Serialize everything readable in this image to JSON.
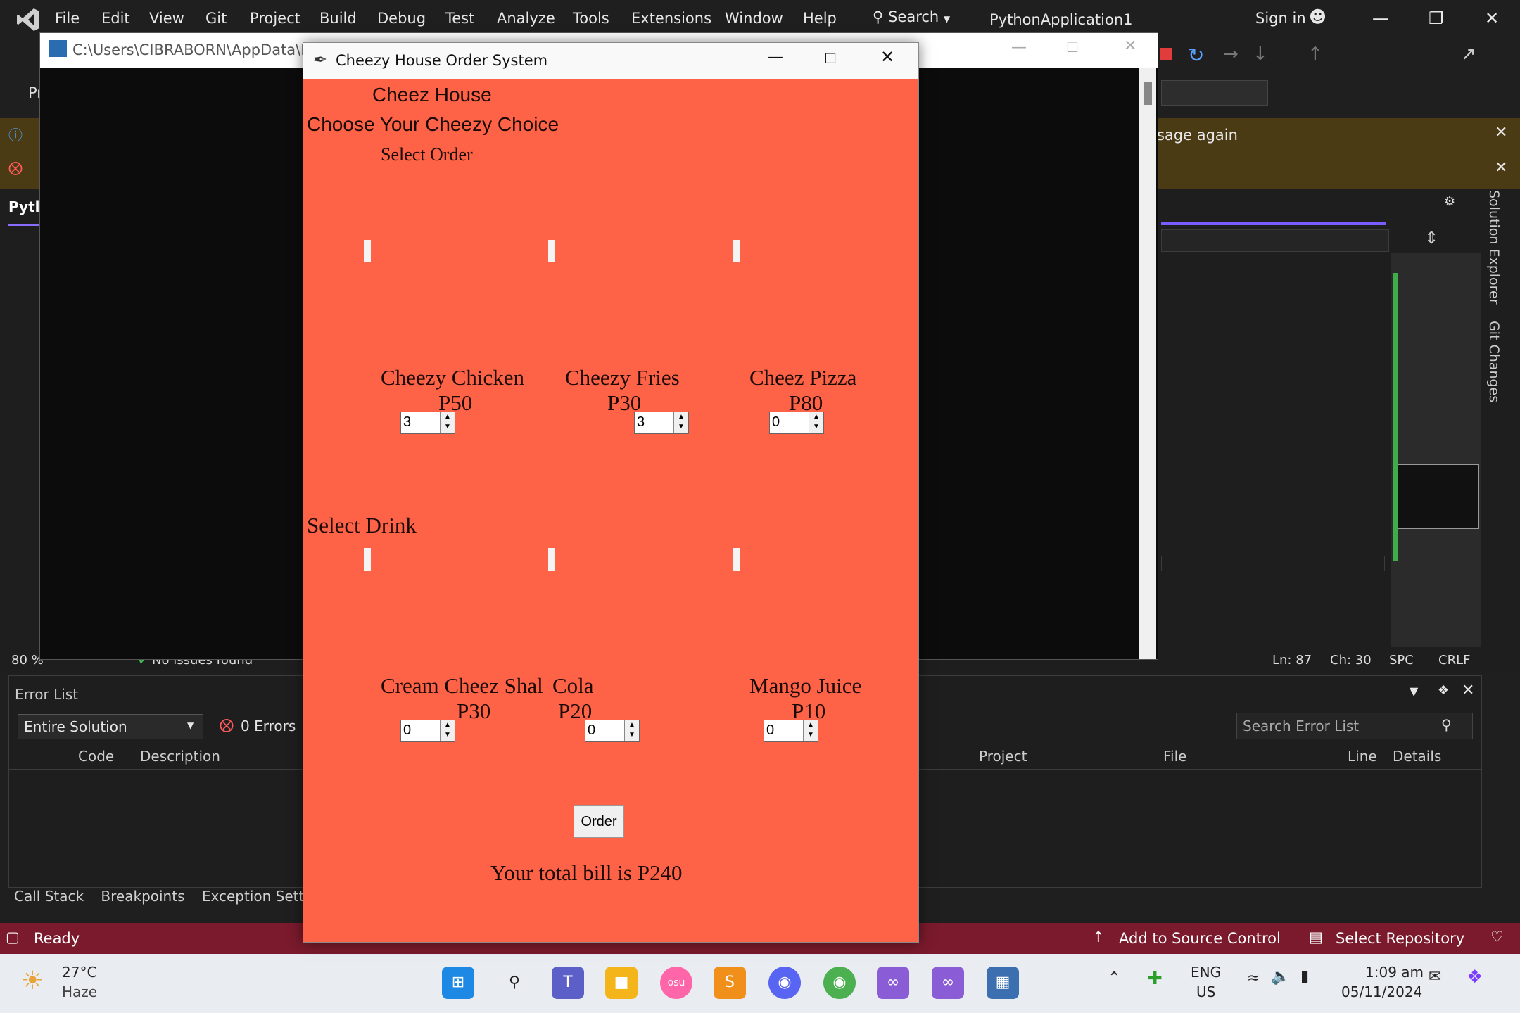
{
  "vs": {
    "menu": [
      "File",
      "Edit",
      "View",
      "Git",
      "Project",
      "Build",
      "Debug",
      "Test",
      "Analyze",
      "Tools",
      "Extensions",
      "Window",
      "Help"
    ],
    "search_label": "Search",
    "app_name": "PythonApplication1",
    "sign_in": "Sign in",
    "info_text": "sage again",
    "editor_tab": "Pytl",
    "side_tabs": [
      "Solution Explorer",
      "Git Changes"
    ],
    "zoom": "80 %",
    "issues": "No issues found",
    "ln": "Ln: 87",
    "ch": "Ch: 30",
    "spc": "SPC",
    "crlf": "CRLF",
    "toolbar_pr": "Pr"
  },
  "error_list": {
    "title": "Error List",
    "scope": "Entire Solution",
    "errors": "0 Errors",
    "search_placeholder": "Search Error List",
    "columns": [
      "Code",
      "Description",
      "Project",
      "File",
      "Line",
      "Details"
    ]
  },
  "bottom_tabs": [
    "Call Stack",
    "Breakpoints",
    "Exception Settings"
  ],
  "status": {
    "ready": "Ready",
    "source_control": "Add to Source Control",
    "repository": "Select Repository"
  },
  "console": {
    "title": "C:\\Users\\CIBRABORN\\AppData\\Loc"
  },
  "tk": {
    "window_title": "Cheezy House Order System",
    "heading": "Cheez House",
    "subheading": "Choose Your Cheezy Choice",
    "select_order": "Select Order",
    "select_drink": "Select Drink",
    "food": [
      {
        "name": "Cheezy Chicken",
        "price": "P50",
        "qty": "3"
      },
      {
        "name": "Cheezy Fries",
        "price": "P30",
        "qty": "3"
      },
      {
        "name": "Cheez Pizza",
        "price": "P80",
        "qty": "0"
      }
    ],
    "drinks": [
      {
        "name": "Cream Cheez Shal",
        "price": "P30",
        "qty": "0"
      },
      {
        "name": "Cola",
        "price": "P20",
        "qty": "0"
      },
      {
        "name": "Mango Juice",
        "price": "P10",
        "qty": "0"
      }
    ],
    "order_button": "Order",
    "total": "Your total bill is P240"
  },
  "taskbar": {
    "temp": "27°C",
    "weather": "Haze",
    "lang": "ENG",
    "region": "US",
    "time": "1:09 am",
    "date": "05/11/2024"
  },
  "colors": {
    "tk_bg": "#ff6347",
    "status_bar": "#7a1a2c",
    "info_bar": "#4a3b14"
  }
}
